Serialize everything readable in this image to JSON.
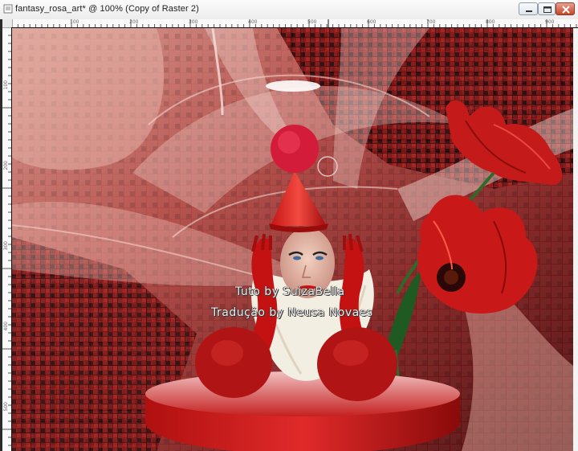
{
  "window": {
    "title": "fantasy_rosa_art* @ 100% (Copy of Raster 2)"
  },
  "ruler": {
    "top_labels": [
      "100",
      "200",
      "300",
      "400",
      "500",
      "600",
      "700",
      "800",
      "900"
    ],
    "left_labels": [
      "100",
      "200",
      "300",
      "400",
      "500"
    ]
  },
  "artwork": {
    "watermark_line1": "Tuto by  SuizaBella",
    "watermark_line2": "Tradução by  Neusa Novaes"
  },
  "colors": {
    "titlebar": "#f0f0f0",
    "artwork_primary": "#c61a1a",
    "artwork_background": "#6a1a1a",
    "close_button": "#c6452a"
  }
}
